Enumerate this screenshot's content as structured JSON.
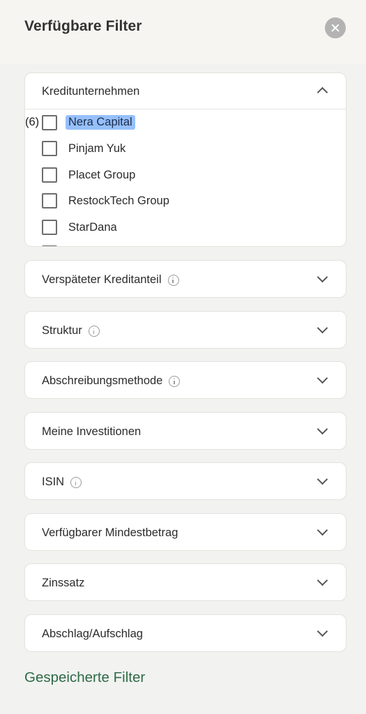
{
  "header": {
    "title": "Verfügbare Filter"
  },
  "lender": {
    "label": "Kreditunternehmen",
    "count": "(6)",
    "options": [
      "Nera Capital",
      "Pinjam Yuk",
      "Placet Group",
      "RestockTech Group",
      "StarDana",
      ""
    ]
  },
  "filters": [
    {
      "label": "Verspäteter Kreditanteil"
    },
    {
      "label": "Struktur"
    },
    {
      "label": "Abschreibungsmethode"
    },
    {
      "label": "Meine Investitionen"
    },
    {
      "label": "ISIN"
    },
    {
      "label": "Verfügbarer Mindestbetrag"
    },
    {
      "label": "Zinssatz"
    },
    {
      "label": "Abschlag/Aufschlag"
    }
  ],
  "saved_filters": "Gespeicherte Filter",
  "colors": {
    "accent_green": "#2e6b47",
    "selection": "#5b9cf5",
    "close_button": "#b3b3b3"
  }
}
